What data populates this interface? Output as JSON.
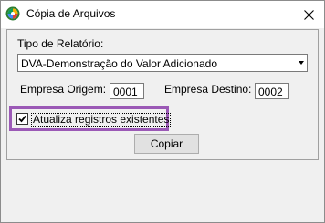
{
  "window": {
    "title": "Cópia de Arquivos",
    "close_glyph": "✕"
  },
  "form": {
    "report_type_label": "Tipo de Relatório:",
    "report_type_value": "DVA-Demonstração do Valor Adicionado",
    "origin_label": "Empresa Origem:",
    "origin_value": "0001",
    "destination_label": "Empresa Destino:",
    "destination_value": "0002",
    "update_checkbox_label": "Atualiza registros existentes",
    "update_checked": true,
    "copy_button_label": "Copiar"
  },
  "icons": {
    "app": "app-logo-icon",
    "close": "close-icon",
    "dropdown": "chevron-down-icon",
    "check": "check-icon"
  },
  "colors": {
    "highlight": "#9b59b6"
  }
}
